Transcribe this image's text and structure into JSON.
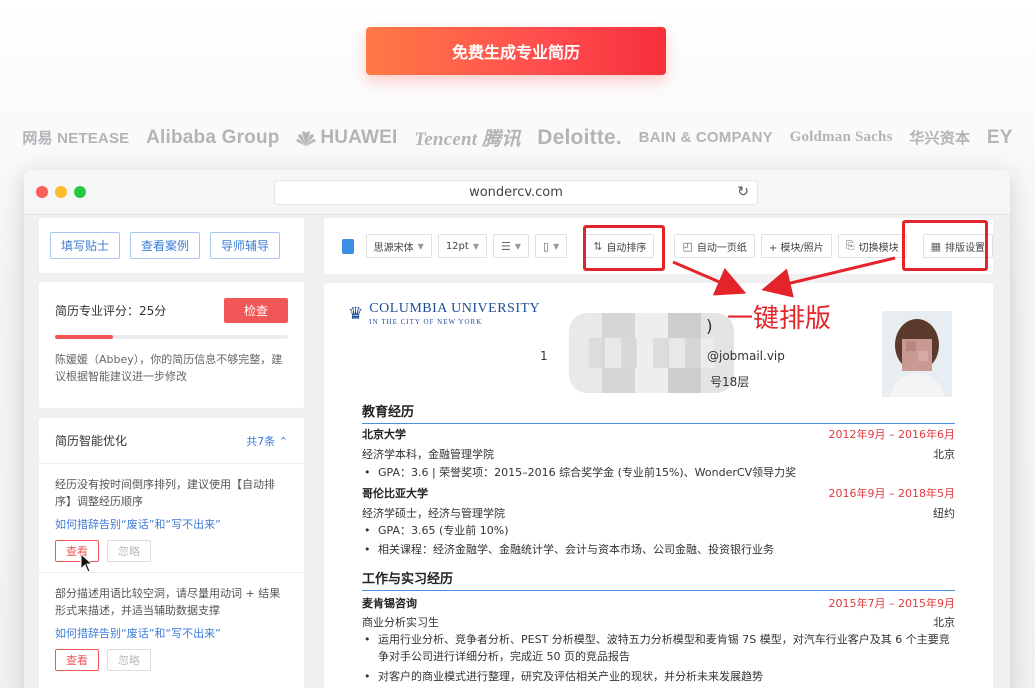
{
  "cta": {
    "label": "免费生成专业简历"
  },
  "logos": [
    "网易 NETEASE",
    "Alibaba Group",
    "HUAWEI",
    "Tencent 腾讯",
    "Deloitte.",
    "BAIN & COMPANY",
    "Goldman Sachs",
    "华兴资本",
    "EY"
  ],
  "browser": {
    "url": "wondercv.com"
  },
  "sidebar": {
    "tabs": [
      "填写贴士",
      "查看案例",
      "导师辅导"
    ],
    "score": {
      "label": "简历专业评分：25分",
      "value": 25,
      "check_label": "检查",
      "message": "陈媛媛（Abbey），你的简历信息不够完整，建议根据智能建议进一步修改"
    },
    "optimize": {
      "title": "简历智能优化",
      "count": "共7条",
      "items": [
        {
          "text": "经历没有按时间倒序排列，建议使用【自动排序】调整经历顺序",
          "link": "如何措辞告别“废话”和“写不出来”",
          "view": "查看",
          "ignore": "忽略"
        },
        {
          "text": "部分描述用语比较空洞，请尽量用动词 + 结果形式来描述，并适当辅助数据支撑",
          "link": "如何措辞告别“废话”和“写不出来”",
          "view": "查看",
          "ignore": "忽略"
        }
      ]
    }
  },
  "toolbar": {
    "accent_color": "#3d8fe6",
    "font": "思源宋体",
    "size": "12pt",
    "auto_sort": "自动排序",
    "one_page": "自动一页纸",
    "module_photo": "+ 模块/照片",
    "switch_module": "切换模块",
    "layout_settings": "排版设置"
  },
  "annotation": {
    "text": "一键排版"
  },
  "resume": {
    "university": "Columbia University",
    "university_sub": "IN THE CITY OF NEW YORK",
    "name_tail": ")",
    "email_tail": "@jobmail.vip",
    "phone_head": "1",
    "address_tail": "号18层",
    "education": {
      "title": "教育经历",
      "entries": [
        {
          "school": "北京大学",
          "dates": "2012年9月 – 2016年6月",
          "degree": "经济学本科，金融管理学院",
          "location": "北京",
          "bullets": [
            "GPA：3.6 | 荣誉奖项：2015–2016 综合奖学金 (专业前15%)、WonderCV领导力奖"
          ]
        },
        {
          "school": "哥伦比亚大学",
          "dates": "2016年9月 – 2018年5月",
          "degree": "经济学硕士，经济与管理学院",
          "location": "纽约",
          "bullets": [
            "GPA：3.65 (专业前 10%)",
            "相关课程：经济金融学、金融统计学、会计与资本市场、公司金融、投资银行业务"
          ]
        }
      ]
    },
    "work": {
      "title": "工作与实习经历",
      "entries": [
        {
          "company": "麦肯锡咨询",
          "dates": "2015年7月 – 2015年9月",
          "role": "商业分析实习生",
          "location": "北京",
          "bullets": [
            "运用行业分析、竞争者分析、PEST 分析模型、波特五力分析模型和麦肯锡 7S 模型，对汽车行业客户及其 6 个主要竞争对手公司进行详细分析，完成近 50 页的竞品报告",
            "对客户的商业模式进行整理，研究及评估相关产业的现状，并分析未来发展趋势"
          ]
        }
      ]
    }
  }
}
